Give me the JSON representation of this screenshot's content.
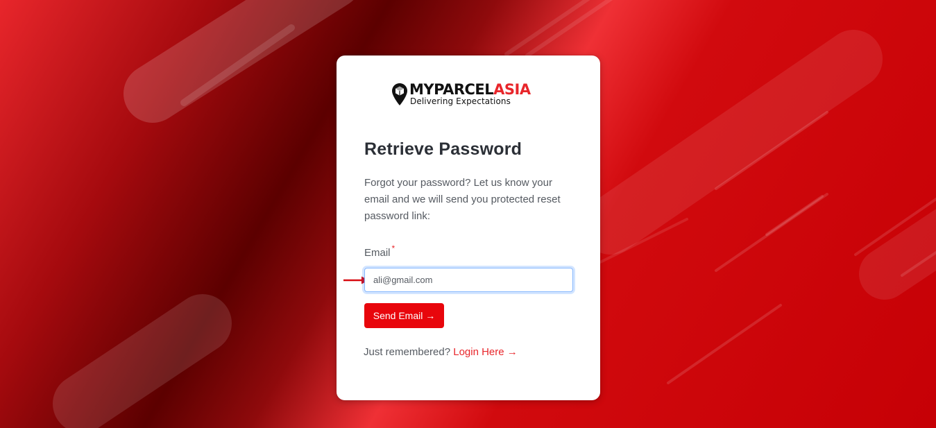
{
  "brand": {
    "name_part1": "MYPARCEL",
    "name_part2": "ASIA",
    "tagline": "Delivering Expectations",
    "colors": {
      "red": "#e8262b",
      "black": "#111111"
    },
    "icon": "location-pin-box-icon"
  },
  "form": {
    "title": "Retrieve Password",
    "description": "Forgot your password? Let us know your email and we will send you protected reset password link:",
    "email_label": "Email",
    "required_marker": "*",
    "email_value": "ali@gmail.com",
    "submit_label": "Send Email →"
  },
  "footer": {
    "prompt": "Just remembered?",
    "login_label": "Login Here →"
  },
  "annotation": {
    "icon": "red-arrow-pointer-icon",
    "color": "#d80a10"
  },
  "theme": {
    "accent": "#e8060c",
    "focus_border": "#86b7fe"
  }
}
